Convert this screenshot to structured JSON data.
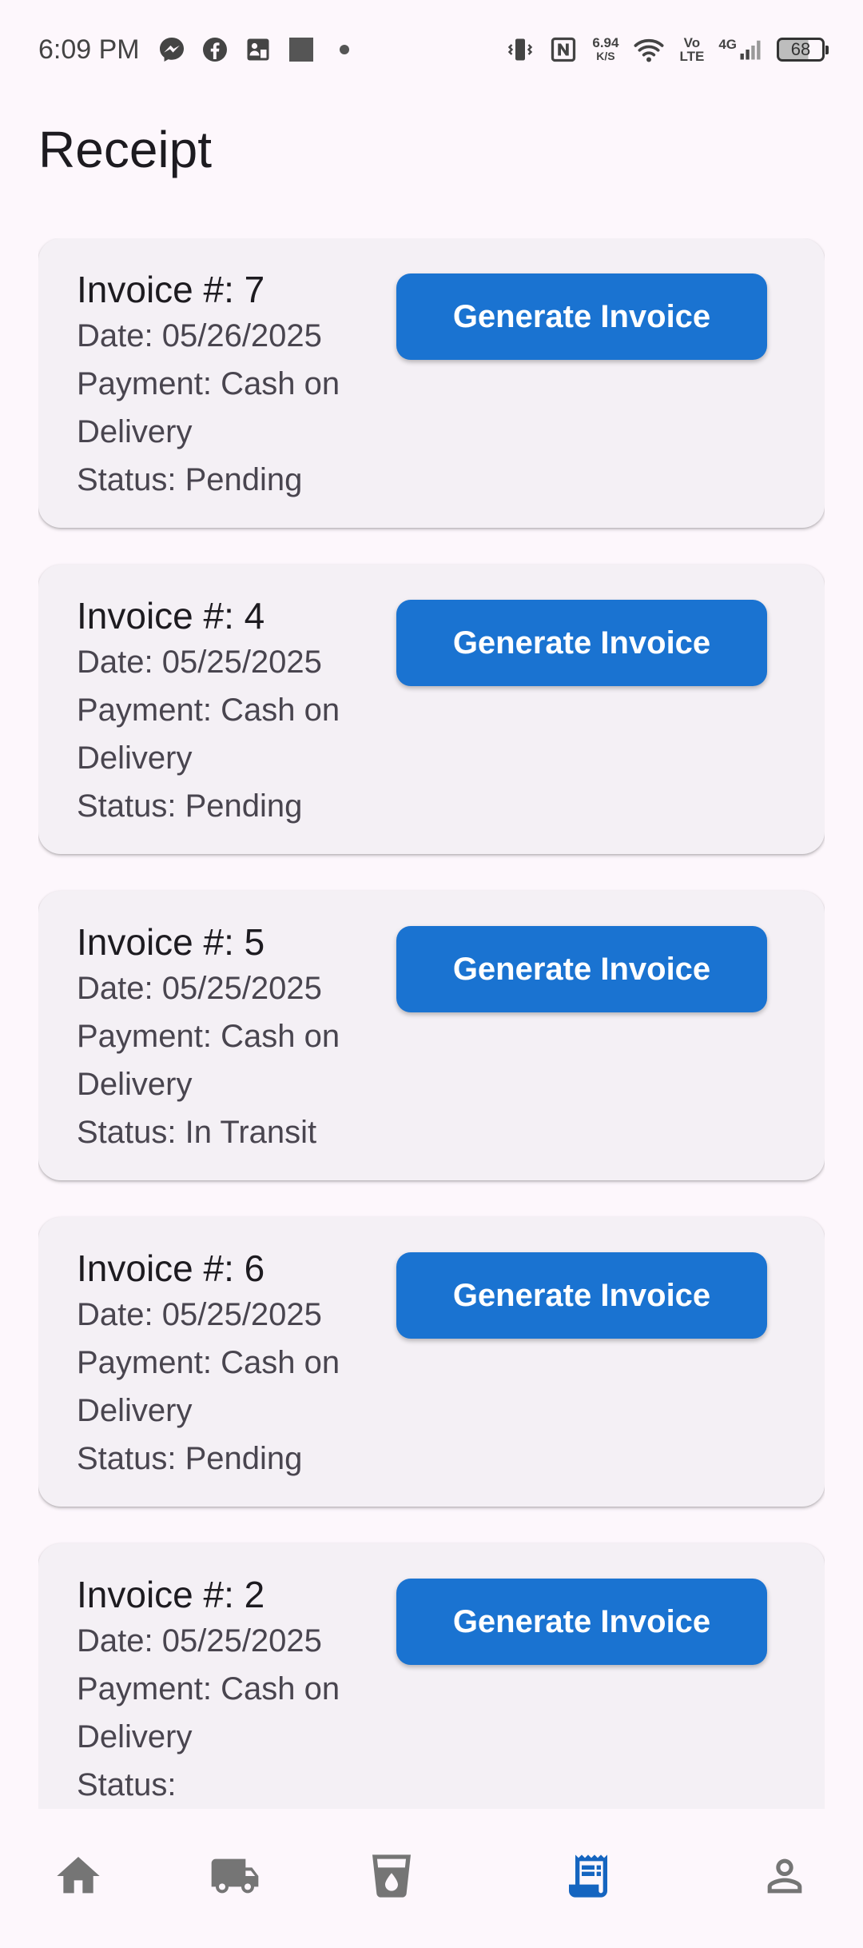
{
  "status_bar": {
    "time": "6:09 PM",
    "speed_value": "6.94",
    "speed_unit": "K/S",
    "volte_top": "Vo",
    "volte_bottom": "LTE",
    "network": "4G",
    "battery": "68",
    "left_icons": [
      "messenger-icon",
      "facebook-icon",
      "facebook-page-icon",
      "square-notification-icon",
      "dot-icon"
    ],
    "right_icons": [
      "vibrate-icon",
      "nfc-icon",
      "wifi-icon",
      "signal-icon"
    ]
  },
  "header": {
    "title": "Receipt"
  },
  "button_label": "Generate Invoice",
  "invoices": [
    {
      "title": "Invoice #: 7",
      "date": "Date: 05/26/2025",
      "payment_line1": "Payment: Cash on",
      "payment_line2": "Delivery",
      "status": "Status: Pending"
    },
    {
      "title": "Invoice #: 4",
      "date": "Date: 05/25/2025",
      "payment_line1": "Payment: Cash on",
      "payment_line2": "Delivery",
      "status": "Status: Pending"
    },
    {
      "title": "Invoice #: 5",
      "date": "Date: 05/25/2025",
      "payment_line1": "Payment: Cash on",
      "payment_line2": "Delivery",
      "status": "Status: In Transit"
    },
    {
      "title": "Invoice #: 6",
      "date": "Date: 05/25/2025",
      "payment_line1": "Payment: Cash on",
      "payment_line2": "Delivery",
      "status": "Status: Pending"
    },
    {
      "title": "Invoice #: 2",
      "date": "Date: 05/25/2025",
      "payment_line1": "Payment: Cash on",
      "payment_line2": "Delivery",
      "status": "Status:"
    }
  ],
  "bottom_nav": {
    "items": [
      {
        "icon": "home-icon",
        "active": false
      },
      {
        "icon": "truck-icon",
        "active": false
      },
      {
        "icon": "water-cup-icon",
        "active": false
      },
      {
        "icon": "receipt-icon",
        "active": true
      },
      {
        "icon": "profile-icon",
        "active": false
      }
    ]
  },
  "colors": {
    "background": "#fdf7fc",
    "card": "#f4f0f5",
    "primary": "#1a73d1",
    "nav_inactive": "#757575",
    "nav_active": "#1565c0"
  }
}
